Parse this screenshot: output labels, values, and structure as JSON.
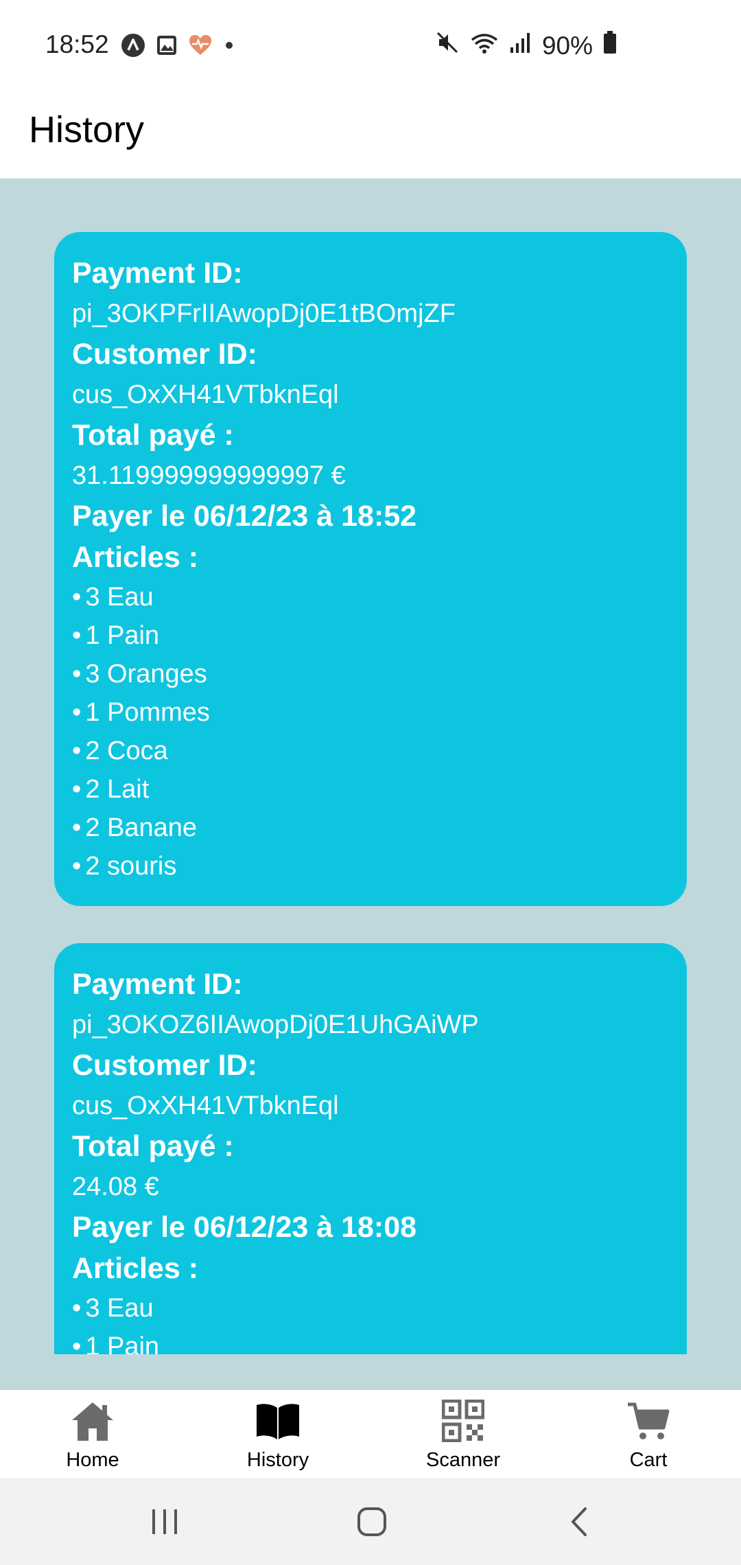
{
  "status_bar": {
    "time": "18:52",
    "battery": "90%",
    "left_icons": [
      "app-a-icon",
      "gallery-icon",
      "health-heart-icon",
      "dot-icon"
    ],
    "right_icons": [
      "mute-icon",
      "wifi-icon",
      "signal-icon",
      "battery-icon"
    ]
  },
  "header": {
    "title": "History"
  },
  "payments": [
    {
      "payment_label": "Payment ID:",
      "payment_id": "pi_3OKPFrIIAwopDj0E1tBOmjZF",
      "customer_label": "Customer ID:",
      "customer_id": "cus_OxXH41VTbknEql",
      "total_label": "Total payé :",
      "total": "31.119999999999997 €",
      "date_line": "Payer le 06/12/23 à 18:52",
      "articles_label": "Articles :",
      "articles": [
        "3 Eau",
        "1 Pain",
        "3 Oranges",
        "1 Pommes",
        "2 Coca",
        "2 Lait",
        "2 Banane",
        "2 souris"
      ]
    },
    {
      "payment_label": "Payment ID:",
      "payment_id": "pi_3OKOZ6IIAwopDj0E1UhGAiWP",
      "customer_label": "Customer ID:",
      "customer_id": "cus_OxXH41VTbknEql",
      "total_label": "Total payé :",
      "total": "24.08 €",
      "date_line": "Payer le 06/12/23 à 18:08",
      "articles_label": "Articles :",
      "articles": [
        "3 Eau",
        "1 Pain"
      ]
    }
  ],
  "bottom_nav": {
    "items": [
      {
        "label": "Home",
        "icon": "home-icon"
      },
      {
        "label": "History",
        "icon": "book-icon"
      },
      {
        "label": "Scanner",
        "icon": "qr-code-icon"
      },
      {
        "label": "Cart",
        "icon": "cart-icon"
      }
    ]
  },
  "colors": {
    "card": "#0ec5e0",
    "background": "#bfd8dc",
    "nav_icon": "#6b6b6b"
  }
}
